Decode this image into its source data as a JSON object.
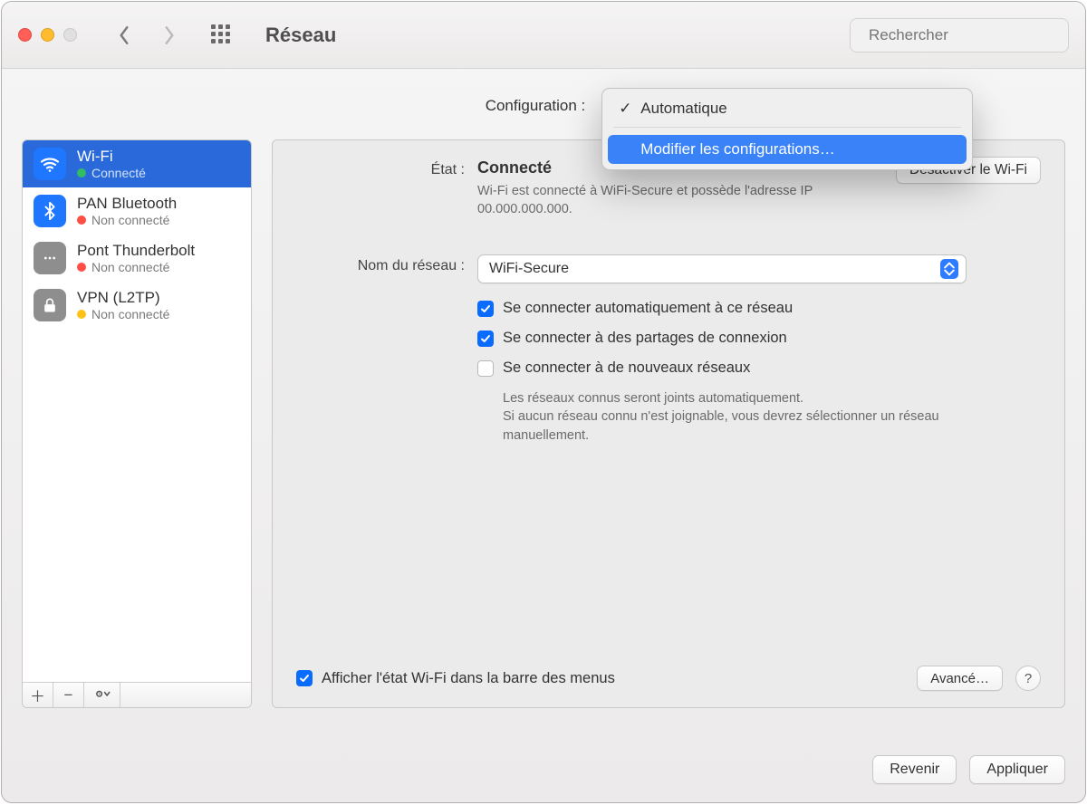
{
  "toolbar": {
    "title": "Réseau",
    "search_placeholder": "Rechercher"
  },
  "config": {
    "label": "Configuration :",
    "options": {
      "automatic": "Automatique",
      "edit": "Modifier les configurations…"
    }
  },
  "sidebar": {
    "items": [
      {
        "name": "Wi-Fi",
        "status": "Connecté",
        "dot": "green"
      },
      {
        "name": "PAN Bluetooth",
        "status": "Non connecté",
        "dot": "red"
      },
      {
        "name": "Pont Thunderbolt",
        "status": "Non connecté",
        "dot": "red"
      },
      {
        "name": "VPN (L2TP)",
        "status": "Non connecté",
        "dot": "amber"
      }
    ]
  },
  "main": {
    "state_label": "État :",
    "state_value": "Connecté",
    "state_desc": "Wi-Fi est connecté à WiFi-Secure et possède l'adresse IP 00.000.000.000.",
    "disable_btn": "Désactiver le Wi-Fi",
    "network_label": "Nom du réseau :",
    "network_value": "WiFi-Secure",
    "check_auto": "Se connecter automatiquement à ce réseau",
    "check_hotspot": "Se connecter à des partages de connexion",
    "check_new": "Se connecter à de nouveaux réseaux",
    "hint": "Les réseaux connus seront joints automatiquement.\nSi aucun réseau connu n'est joignable, vous devrez sélectionner un réseau manuellement.",
    "show_status": "Afficher l'état Wi-Fi dans la barre des menus",
    "advanced_btn": "Avancé…"
  },
  "footer": {
    "revert": "Revenir",
    "apply": "Appliquer"
  }
}
